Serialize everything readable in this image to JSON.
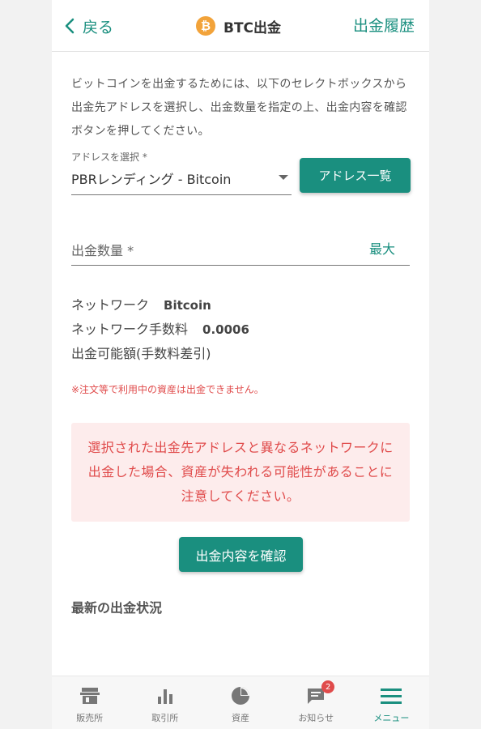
{
  "header": {
    "back_label": "戻る",
    "title": "BTC出金",
    "coin_symbol": "₿",
    "history_label": "出金履歴"
  },
  "description": "ビットコインを出金するためには、以下のセレクトボックスから出金先アドレスを選択し、出金数量を指定の上、出金内容を確認ボタンを押してください。",
  "address": {
    "label": "アドレスを選択 *",
    "selected": "PBRレンディング - Bitcoin",
    "list_button": "アドレス一覧"
  },
  "amount": {
    "label": "出金数量 *",
    "max_label": "最大"
  },
  "info": {
    "network_label": "ネットワーク",
    "network_value": "Bitcoin",
    "fee_label": "ネットワーク手数料",
    "fee_value": "0.0006",
    "available_label": "出金可能額(手数料差引)"
  },
  "note": "※注文等で利用中の資産は出金できません。",
  "warning": "選択された出金先アドレスと異なるネットワークに出金した場合、資産が失われる可能性があることに注意してください。",
  "confirm_button": "出金内容を確認",
  "recent_title": "最新の出金状況",
  "bottom_nav": {
    "items": [
      {
        "label": "販売所",
        "icon": "store-icon"
      },
      {
        "label": "取引所",
        "icon": "bar-chart-icon"
      },
      {
        "label": "資産",
        "icon": "pie-chart-icon"
      },
      {
        "label": "お知らせ",
        "icon": "message-icon",
        "badge": "2"
      },
      {
        "label": "メニュー",
        "icon": "menu-icon",
        "active": true
      }
    ]
  },
  "colors": {
    "accent": "#1a8f7f",
    "warning_text": "#e04b4b",
    "warning_bg": "#fdecec",
    "bitcoin": "#f2a33a"
  }
}
